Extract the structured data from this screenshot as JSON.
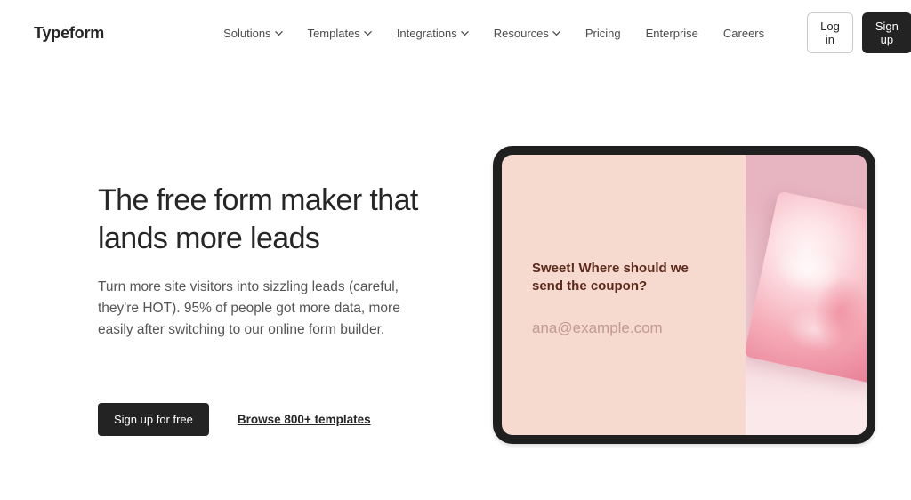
{
  "brand": "Typeform",
  "nav": {
    "items": [
      {
        "label": "Solutions",
        "hasDropdown": true
      },
      {
        "label": "Templates",
        "hasDropdown": true
      },
      {
        "label": "Integrations",
        "hasDropdown": true
      },
      {
        "label": "Resources",
        "hasDropdown": true
      },
      {
        "label": "Pricing",
        "hasDropdown": false
      },
      {
        "label": "Enterprise",
        "hasDropdown": false
      },
      {
        "label": "Careers",
        "hasDropdown": false
      }
    ]
  },
  "auth": {
    "login": "Log in",
    "signup": "Sign up"
  },
  "hero": {
    "headline": "The free form maker that lands more leads",
    "subtext": "Turn more site visitors into sizzling leads (careful, they're HOT). 95% of people got more data, more easily after switching to our online form builder.",
    "cta_primary": "Sign up for free",
    "cta_secondary": "Browse 800+ templates"
  },
  "tablet": {
    "question": "Sweet! Where should we send the coupon?",
    "email_placeholder": "ana@example.com"
  }
}
